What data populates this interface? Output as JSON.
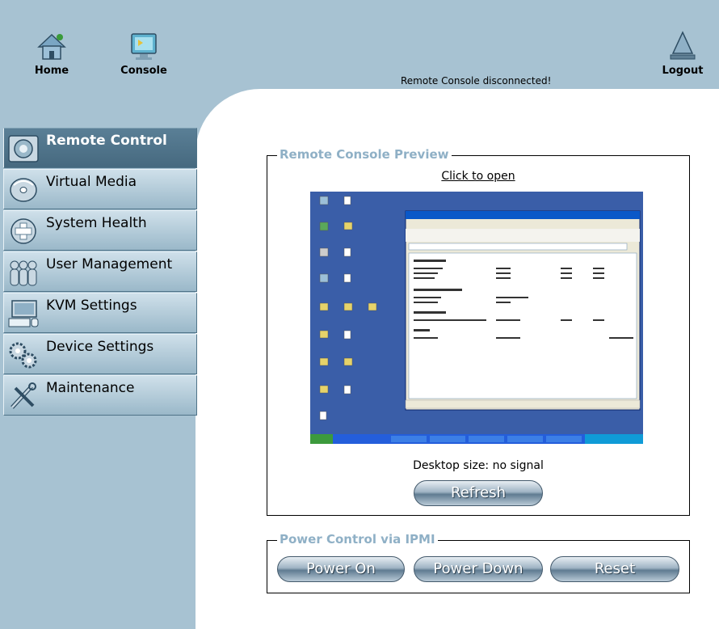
{
  "toolbar": {
    "home_label": "Home",
    "console_label": "Console",
    "logout_label": "Logout",
    "status_message": "Remote Console disconnected!"
  },
  "sidebar": {
    "items": [
      {
        "label": "Remote Control",
        "icon": "remote-control-icon",
        "active": true
      },
      {
        "label": "Virtual Media",
        "icon": "disc-icon",
        "active": false
      },
      {
        "label": "System Health",
        "icon": "health-cross-icon",
        "active": false
      },
      {
        "label": "User Management",
        "icon": "users-icon",
        "active": false
      },
      {
        "label": "KVM Settings",
        "icon": "keyboard-monitor-icon",
        "active": false
      },
      {
        "label": "Device Settings",
        "icon": "gears-icon",
        "active": false
      },
      {
        "label": "Maintenance",
        "icon": "tools-icon",
        "active": false
      }
    ]
  },
  "preview": {
    "legend": "Remote Console Preview",
    "click_to_open": "Click to open",
    "desktop_size": "Desktop size: no signal",
    "refresh_label": "Refresh"
  },
  "power": {
    "legend": "Power Control via IPMI",
    "power_on_label": "Power On",
    "power_down_label": "Power Down",
    "reset_label": "Reset"
  },
  "colors": {
    "sidebar_bg": "#a7c2d2",
    "active_item": "#4f7388",
    "legend_text": "#8fb0c6",
    "desktop_blue": "#3a5ea8"
  }
}
